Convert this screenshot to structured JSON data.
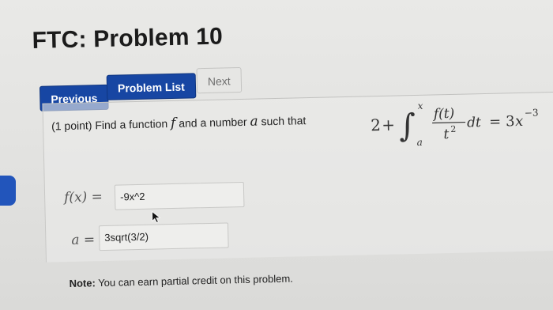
{
  "page": {
    "title": "FTC: Problem 10"
  },
  "nav": {
    "previous": "Previous",
    "problem_list": "Problem List",
    "next": "Next"
  },
  "problem": {
    "points": "(1 point)",
    "prompt_text_1": "Find a function",
    "prompt_var_f": "f",
    "prompt_text_2": "and a number",
    "prompt_var_a": "a",
    "prompt_text_3": "such that"
  },
  "equation": {
    "lhs_constant": "2",
    "plus": "+",
    "upper_limit": "x",
    "lower_limit": "a",
    "numerator": "f(t)",
    "denominator": "t",
    "denominator_exp": "2",
    "differential": "dt",
    "equals": "=",
    "rhs_coef": "3",
    "rhs_var": "x",
    "rhs_exp": "−3"
  },
  "answers": {
    "f_label": "f(x) =",
    "f_value": "-9x^2",
    "a_label": "a =",
    "a_value": "3sqrt(3/2)"
  },
  "note": {
    "label": "Note:",
    "text": "You can earn partial credit on this problem."
  }
}
